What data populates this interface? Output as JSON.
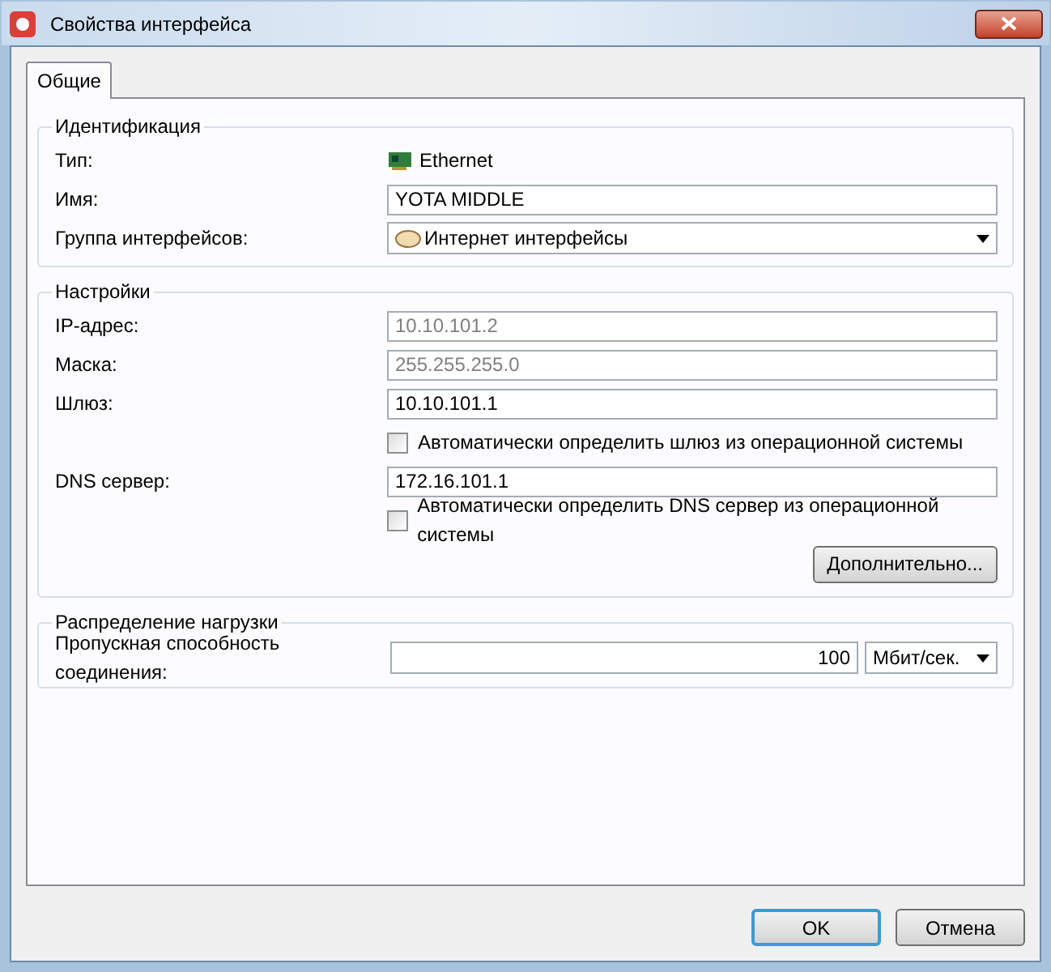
{
  "window": {
    "title": "Свойства интерфейса"
  },
  "tabs": [
    {
      "label": "Общие",
      "selected": true
    }
  ],
  "groups": [
    {
      "title": "Идентификация",
      "rows": [
        {
          "kind": "static",
          "label": "Тип:",
          "value": "Ethernet"
        },
        {
          "kind": "field",
          "label": "Имя:",
          "value": "YOTA MIDDLE",
          "disabled": false
        },
        {
          "kind": "select",
          "label": "Группа интерфейсов:",
          "value": "Интернет интерфейсы"
        }
      ]
    },
    {
      "title": "Настройки",
      "rows": [
        {
          "kind": "field",
          "label": "IP-адрес:",
          "value": "10.10.101.2",
          "disabled": true
        },
        {
          "kind": "field",
          "label": "Маска:",
          "value": "255.255.255.0",
          "disabled": true
        },
        {
          "kind": "field",
          "label": "Шлюз:",
          "value": "10.10.101.1",
          "disabled": false
        },
        {
          "kind": "checkbox",
          "label": "Автоматически определить шлюз из операционной системы",
          "checked": false
        },
        {
          "kind": "field",
          "label": "DNS сервер:",
          "value": "172.16.101.1",
          "disabled": false
        },
        {
          "kind": "checkbox",
          "label": "Автоматически определить DNS сервер из операционной системы",
          "checked": false
        },
        {
          "kind": "button",
          "label": "Дополнительно..."
        }
      ]
    },
    {
      "title": "Распределение нагрузки",
      "rows": [
        {
          "kind": "bandwidth",
          "label": "Пропускная способность соединения:",
          "value": "100",
          "unit": "Мбит/сек."
        }
      ]
    }
  ],
  "buttons": [
    {
      "label": "OK",
      "default": true
    },
    {
      "label": "Отмена",
      "default": false
    }
  ]
}
